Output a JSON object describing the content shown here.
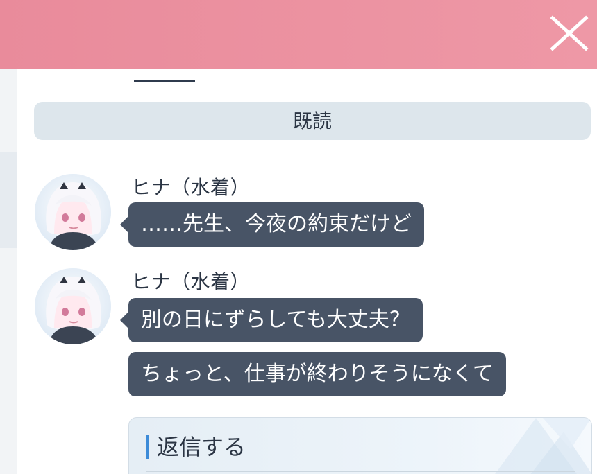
{
  "header": {
    "close_icon": "close-icon",
    "background_color": "#ec93a2"
  },
  "read_status": "既読",
  "messages": [
    {
      "speaker": "ヒナ（水着）",
      "text": "……先生、今夜の約束だけど"
    },
    {
      "speaker": "ヒナ（水着）",
      "text": "別の日にずらしても大丈夫？"
    },
    {
      "text": "ちょっと、仕事が終わりそうになくて"
    }
  ],
  "reply": {
    "label": "返信する",
    "accent_color": "#3d8bd8"
  },
  "colors": {
    "bubble": "#485466",
    "read_bar": "#dde6ec",
    "text": "#2b3544"
  }
}
